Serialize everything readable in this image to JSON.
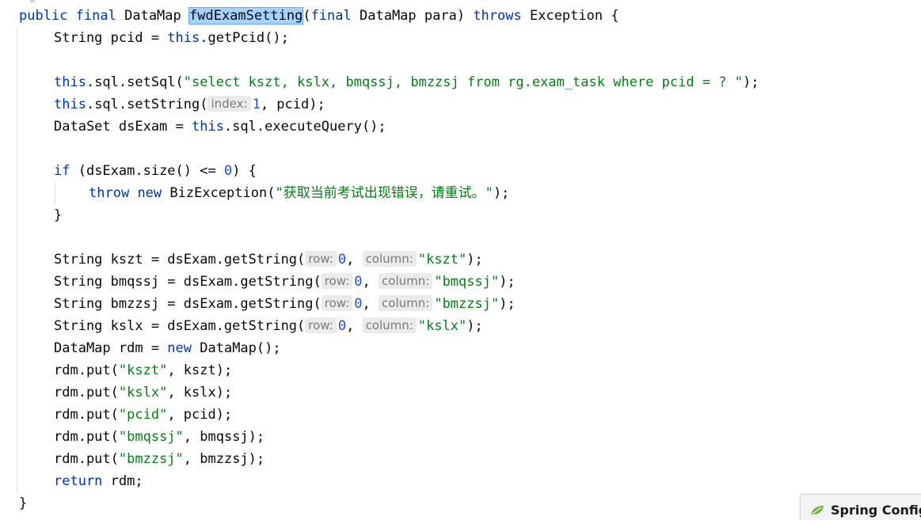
{
  "code": {
    "l1": {
      "kw_public": "public",
      "kw_final": "final",
      "type": "DataMap",
      "method": "fwdExamSetting",
      "open_paren": "(",
      "kw_final2": "final",
      "param": "DataMap para)",
      "kw_throws": "throws",
      "rest": "Exception {"
    },
    "l2": {
      "a": "String pcid = ",
      "kw": "this",
      "b": ".getPcid();"
    },
    "l4": {
      "kw": "this",
      "a": ".sql.setSql(",
      "s": "\"select kszt, kslx, bmqssj, bmzzsj from rg.exam_task where pcid = ? \"",
      "b": ");"
    },
    "l5": {
      "kw": "this",
      "a": ".sql.setString(",
      "hint": "index:",
      "n": "1",
      "b": ", pcid);"
    },
    "l6": {
      "a": "DataSet dsExam = ",
      "kw": "this",
      "b": ".sql.executeQuery();"
    },
    "l8": {
      "kw": "if",
      "a": " (dsExam.size() <= ",
      "n": "0",
      "b": ") {"
    },
    "l9": {
      "kw1": "throw",
      "kw2": "new",
      "a": " BizException(",
      "s": "\"获取当前考试出现错误，请重试。\"",
      "b": ");"
    },
    "l10": {
      "a": "}"
    },
    "l12": {
      "a": "String kszt = dsExam.getString(",
      "h1": "row:",
      "n": "0",
      "c": ",",
      "h2": "column:",
      "s": "\"kszt\"",
      "b": ");"
    },
    "l13": {
      "a": "String bmqssj = dsExam.getString(",
      "h1": "row:",
      "n": "0",
      "c": ",",
      "h2": "column:",
      "s": "\"bmqssj\"",
      "b": ");"
    },
    "l14": {
      "a": "String bmzzsj = dsExam.getString(",
      "h1": "row:",
      "n": "0",
      "c": ",",
      "h2": "column:",
      "s": "\"bmzzsj\"",
      "b": ");"
    },
    "l15": {
      "a": "String kslx = dsExam.getString(",
      "h1": "row:",
      "n": "0",
      "c": ",",
      "h2": "column:",
      "s": "\"kslx\"",
      "b": ");"
    },
    "l16": {
      "a": "DataMap rdm = ",
      "kw": "new",
      "b": " DataMap();"
    },
    "l17": {
      "a": "rdm.put(",
      "s": "\"kszt\"",
      "b": ", kszt);"
    },
    "l18": {
      "a": "rdm.put(",
      "s": "\"kslx\"",
      "b": ", kslx);"
    },
    "l19": {
      "a": "rdm.put(",
      "s": "\"pcid\"",
      "b": ", pcid);"
    },
    "l20": {
      "a": "rdm.put(",
      "s": "\"bmqssj\"",
      "b": ", bmqssj);"
    },
    "l21": {
      "a": "rdm.put(",
      "s": "\"bmzzsj\"",
      "b": ", bmzzsj);"
    },
    "l22": {
      "kw": "return",
      "b": " rdm;"
    },
    "l23": {
      "a": "}"
    }
  },
  "spring_popup": {
    "icon": "spring-leaf-icon",
    "label": "Spring Config"
  },
  "colors": {
    "keyword": "#0033b3",
    "string": "#067d17",
    "number": "#1750eb",
    "selection": "#a6d2ff"
  }
}
